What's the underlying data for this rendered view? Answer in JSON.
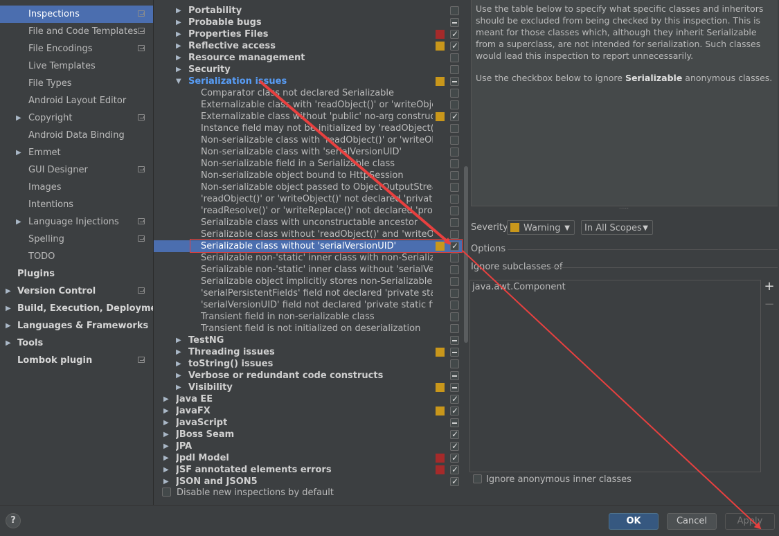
{
  "sidebar": {
    "items": [
      {
        "label": "Inspections",
        "selected": true,
        "project": true
      },
      {
        "label": "File and Code Templates",
        "project": true
      },
      {
        "label": "File Encodings",
        "project": true
      },
      {
        "label": "Live Templates"
      },
      {
        "label": "File Types"
      },
      {
        "label": "Android Layout Editor"
      },
      {
        "label": "Copyright",
        "expandable": true,
        "project": true
      },
      {
        "label": "Android Data Binding"
      },
      {
        "label": "Emmet",
        "expandable": true
      },
      {
        "label": "GUI Designer",
        "project": true
      },
      {
        "label": "Images"
      },
      {
        "label": "Intentions"
      },
      {
        "label": "Language Injections",
        "expandable": true,
        "project": true
      },
      {
        "label": "Spelling",
        "project": true
      },
      {
        "label": "TODO"
      },
      {
        "label": "Plugins",
        "bold": true,
        "top": true
      },
      {
        "label": "Version Control",
        "bold": true,
        "top": true,
        "expandable": true,
        "project": true
      },
      {
        "label": "Build, Execution, Deployment",
        "bold": true,
        "top": true,
        "expandable": true
      },
      {
        "label": "Languages & Frameworks",
        "bold": true,
        "top": true,
        "expandable": true
      },
      {
        "label": "Tools",
        "bold": true,
        "top": true,
        "expandable": true
      },
      {
        "label": "Lombok plugin",
        "bold": true,
        "top": true,
        "project": true
      }
    ]
  },
  "tree": {
    "rows": [
      {
        "label": "Portability",
        "level": 1,
        "group": true,
        "check": "off"
      },
      {
        "label": "Probable bugs",
        "level": 1,
        "group": true,
        "check": "partial"
      },
      {
        "label": "Properties Files",
        "level": 1,
        "group": true,
        "sev": "#a52a2a",
        "check": "on"
      },
      {
        "label": "Reflective access",
        "level": 1,
        "group": true,
        "sev": "#c9971b",
        "check": "on"
      },
      {
        "label": "Resource management",
        "level": 1,
        "group": true,
        "check": "off"
      },
      {
        "label": "Security",
        "level": 1,
        "group": true,
        "check": "off"
      },
      {
        "label": "Serialization issues",
        "level": 1,
        "group": true,
        "expanded": true,
        "blue": true,
        "sev": "#c9971b",
        "check": "partial"
      },
      {
        "label": "Comparator class not declared Serializable",
        "level": 2,
        "check": "off"
      },
      {
        "label": "Externalizable class with 'readObject()' or 'writeObject()'",
        "level": 2,
        "check": "off"
      },
      {
        "label": "Externalizable class without 'public' no-arg constructor",
        "level": 2,
        "sev": "#c9971b",
        "check": "on"
      },
      {
        "label": "Instance field may not be initialized by 'readObject()'",
        "level": 2,
        "check": "off"
      },
      {
        "label": "Non-serializable class with 'readObject()' or 'writeObject()'",
        "level": 2,
        "check": "off"
      },
      {
        "label": "Non-serializable class with 'serialVersionUID'",
        "level": 2,
        "check": "off"
      },
      {
        "label": "Non-serializable field in a Serializable class",
        "level": 2,
        "check": "off"
      },
      {
        "label": "Non-serializable object bound to HttpSession",
        "level": 2,
        "check": "off"
      },
      {
        "label": "Non-serializable object passed to ObjectOutputStream",
        "level": 2,
        "check": "off"
      },
      {
        "label": "'readObject()' or 'writeObject()' not declared 'private'",
        "level": 2,
        "check": "off"
      },
      {
        "label": "'readResolve()' or 'writeReplace()' not declared 'protected'",
        "level": 2,
        "check": "off"
      },
      {
        "label": "Serializable class with unconstructable ancestor",
        "level": 2,
        "check": "off"
      },
      {
        "label": "Serializable class without 'readObject()' and 'writeObject()'",
        "level": 2,
        "check": "off"
      },
      {
        "label": "Serializable class without 'serialVersionUID'",
        "level": 2,
        "selected": true,
        "sev": "#c9971b",
        "check": "on"
      },
      {
        "label": "Serializable non-'static' inner class with non-Serializable outer class",
        "level": 2,
        "check": "off"
      },
      {
        "label": "Serializable non-'static' inner class without 'serialVersionUID'",
        "level": 2,
        "check": "off"
      },
      {
        "label": "Serializable object implicitly stores non-Serializable object",
        "level": 2,
        "check": "off"
      },
      {
        "label": "'serialPersistentFields' field not declared 'private static final'",
        "level": 2,
        "check": "off"
      },
      {
        "label": "'serialVersionUID' field not declared 'private static final long'",
        "level": 2,
        "check": "off"
      },
      {
        "label": "Transient field in non-serializable class",
        "level": 2,
        "check": "off"
      },
      {
        "label": "Transient field is not initialized on deserialization",
        "level": 2,
        "check": "off"
      },
      {
        "label": "TestNG",
        "level": 1,
        "group": true,
        "check": "partial"
      },
      {
        "label": "Threading issues",
        "level": 1,
        "group": true,
        "sev": "#c9971b",
        "check": "partial"
      },
      {
        "label": "toString() issues",
        "level": 1,
        "group": true,
        "check": "off"
      },
      {
        "label": "Verbose or redundant code constructs",
        "level": 1,
        "group": true,
        "check": "partial"
      },
      {
        "label": "Visibility",
        "level": 1,
        "group": true,
        "sev": "#c9971b",
        "check": "partial"
      },
      {
        "label": "Java EE",
        "level": 0,
        "group": true,
        "check": "on"
      },
      {
        "label": "JavaFX",
        "level": 0,
        "group": true,
        "sev": "#c9971b",
        "check": "on"
      },
      {
        "label": "JavaScript",
        "level": 0,
        "group": true,
        "check": "partial"
      },
      {
        "label": "JBoss Seam",
        "level": 0,
        "group": true,
        "check": "on"
      },
      {
        "label": "JPA",
        "level": 0,
        "group": true,
        "check": "on"
      },
      {
        "label": "Jpdl Model",
        "level": 0,
        "group": true,
        "sev": "#a52a2a",
        "check": "on"
      },
      {
        "label": "JSF annotated elements errors",
        "level": 0,
        "group": true,
        "sev": "#a52a2a",
        "check": "on"
      },
      {
        "label": "JSON and JSON5",
        "level": 0,
        "group": true,
        "check": "on"
      }
    ],
    "disable_new_label": "Disable new inspections by default"
  },
  "description": {
    "p1": "Use the table below to specify what specific classes and inheritors should be excluded from being checked by this inspection. This is meant for those classes which, although they inherit Serializable from a superclass, are not intended for serialization. Such classes would lead this inspection to report unnecessarily.",
    "p2_before": "Use the checkbox below to ignore ",
    "p2_bold": "Serializable",
    "p2_after": " anonymous classes."
  },
  "severity": {
    "label": "Severity:",
    "value": "Warning",
    "color": "#c9971b",
    "scope": "In All Scopes"
  },
  "options": {
    "title": "Options",
    "ignore_subclasses_label": "Ignore subclasses of",
    "classes": [
      "java.awt.Component"
    ],
    "ignore_anonymous_label": "Ignore anonymous inner classes"
  },
  "buttons": {
    "help": "?",
    "ok": "OK",
    "cancel": "Cancel",
    "apply": "Apply"
  },
  "annotation_color": "#e8403f"
}
